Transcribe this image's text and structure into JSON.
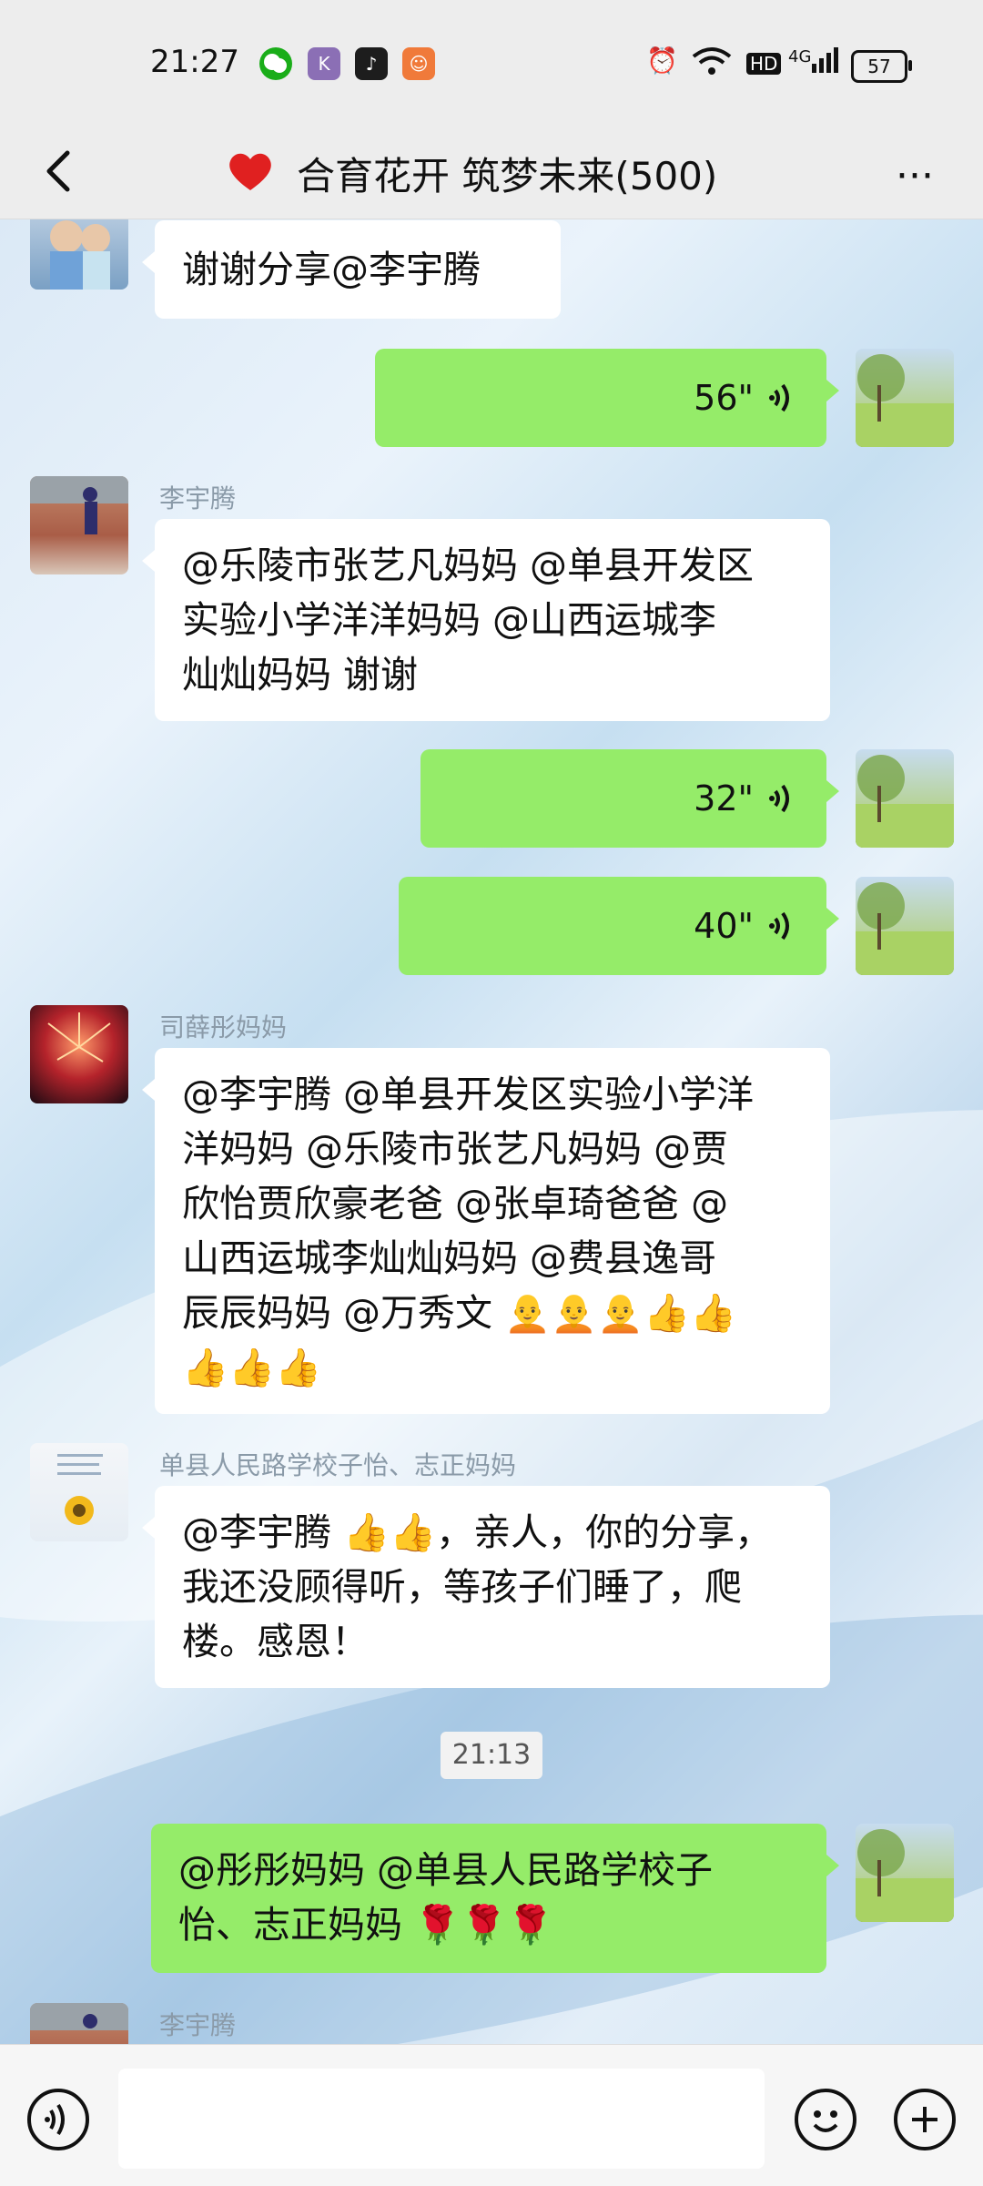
{
  "status": {
    "time": "21:27",
    "battery": "57",
    "network": "4G",
    "hd": "HD",
    "colors": {
      "app1": "#8b6fb5",
      "app2": "#1d1d1d",
      "app3": "#f07a3a"
    }
  },
  "header": {
    "title": "合育花开 筑梦未来(500)",
    "title_icon": "heart-icon",
    "back_icon": "back-arrow-icon",
    "more_icon": "more-icon",
    "more_label": "···"
  },
  "messages": [
    {
      "type": "text-left",
      "text": "谢谢分享@李宇腾"
    },
    {
      "type": "voice-right",
      "duration": "56\""
    },
    {
      "type": "text-left",
      "sender": "李宇腾",
      "lines": [
        "@乐陵市张艺凡妈妈 @单县开发区",
        "实验小学洋洋妈妈 @山西运城李",
        "灿灿妈妈  谢谢"
      ]
    },
    {
      "type": "voice-right",
      "duration": "32\""
    },
    {
      "type": "voice-right",
      "duration": "40\""
    },
    {
      "type": "text-left",
      "sender": "司薛彤妈妈",
      "lines": [
        "@李宇腾 @单县开发区实验小学洋",
        "洋妈妈 @乐陵市张艺凡妈妈 @贾",
        "欣怡贾欣豪老爸 @张卓琦爸爸 @",
        "山西运城李灿灿妈妈 @费县逸哥",
        "辰辰妈妈 @万秀文 🧑‍🦲🧑‍🦲🧑‍🦲👍👍",
        "👍👍👍"
      ]
    },
    {
      "type": "text-left",
      "sender": "单县人民路学校子怡、志正妈妈",
      "lines": [
        "@李宇腾 👍👍，亲人，你的分享，",
        "我还没顾得听，等孩子们睡了，爬",
        "楼。感恩！"
      ]
    },
    {
      "type": "time",
      "text": "21:13"
    },
    {
      "type": "text-right",
      "lines": [
        "@彤彤妈妈 @单县人民路学校子",
        "怡、志正妈妈 🌹🌹🌹"
      ]
    },
    {
      "type": "partial-left",
      "sender": "李宇腾"
    }
  ],
  "bottombar": {
    "voice_icon": "voice-input-icon",
    "emoji_icon": "emoji-icon",
    "plus_icon": "plus-icon",
    "input_value": ""
  }
}
